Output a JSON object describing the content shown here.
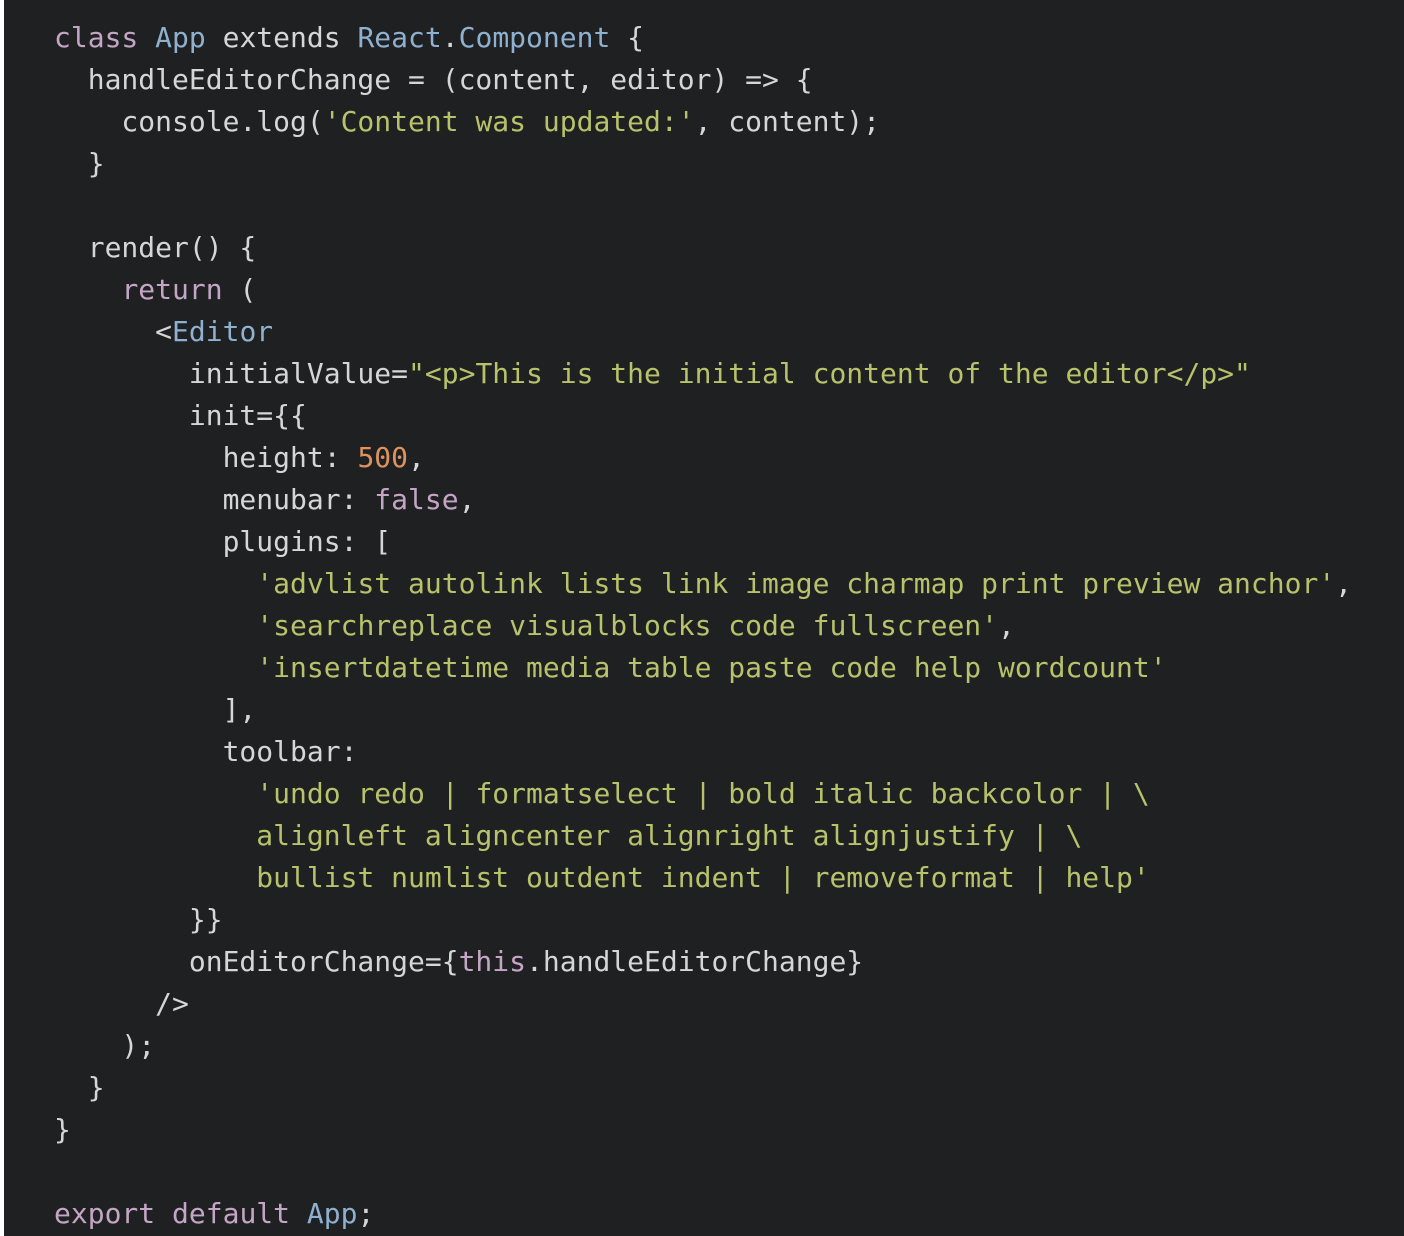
{
  "colors": {
    "background": "#1f2022",
    "plain": "#d6d6d6",
    "keyword": "#c5a5c5",
    "class": "#8fb0cf",
    "string": "#b8c26a",
    "number": "#de935f"
  },
  "code": {
    "language": "jsx",
    "lines": [
      [
        [
          "keyword",
          "class"
        ],
        [
          "plain",
          " "
        ],
        [
          "class",
          "App"
        ],
        [
          "plain",
          " extends "
        ],
        [
          "class",
          "React"
        ],
        [
          "plain",
          "."
        ],
        [
          "class",
          "Component"
        ],
        [
          "plain",
          " {"
        ]
      ],
      [
        [
          "plain",
          "  handleEditorChange = (content, editor) => {"
        ]
      ],
      [
        [
          "plain",
          "    console.log("
        ],
        [
          "string",
          "'Content was updated:'"
        ],
        [
          "plain",
          ", content);"
        ]
      ],
      [
        [
          "plain",
          "  }"
        ]
      ],
      [],
      [
        [
          "plain",
          "  render() {"
        ]
      ],
      [
        [
          "plain",
          "    "
        ],
        [
          "keyword",
          "return"
        ],
        [
          "plain",
          " ("
        ]
      ],
      [
        [
          "plain",
          "      <"
        ],
        [
          "class",
          "Editor"
        ]
      ],
      [
        [
          "plain",
          "        initialValue="
        ],
        [
          "string",
          "\"<p>This is the initial content of the editor</p>\""
        ]
      ],
      [
        [
          "plain",
          "        init={{"
        ]
      ],
      [
        [
          "plain",
          "          height: "
        ],
        [
          "number",
          "500"
        ],
        [
          "plain",
          ","
        ]
      ],
      [
        [
          "plain",
          "          menubar: "
        ],
        [
          "keyword",
          "false"
        ],
        [
          "plain",
          ","
        ]
      ],
      [
        [
          "plain",
          "          plugins: ["
        ]
      ],
      [
        [
          "plain",
          "            "
        ],
        [
          "string",
          "'advlist autolink lists link image charmap print preview anchor'"
        ],
        [
          "plain",
          ","
        ]
      ],
      [
        [
          "plain",
          "            "
        ],
        [
          "string",
          "'searchreplace visualblocks code fullscreen'"
        ],
        [
          "plain",
          ","
        ]
      ],
      [
        [
          "plain",
          "            "
        ],
        [
          "string",
          "'insertdatetime media table paste code help wordcount'"
        ]
      ],
      [
        [
          "plain",
          "          ],"
        ]
      ],
      [
        [
          "plain",
          "          toolbar:"
        ]
      ],
      [
        [
          "plain",
          "            "
        ],
        [
          "string",
          "'undo redo | formatselect | bold italic backcolor | \\"
        ]
      ],
      [
        [
          "plain",
          "            "
        ],
        [
          "string",
          "alignleft aligncenter alignright alignjustify | \\"
        ]
      ],
      [
        [
          "plain",
          "            "
        ],
        [
          "string",
          "bullist numlist outdent indent | removeformat | help'"
        ]
      ],
      [
        [
          "plain",
          "        }}"
        ]
      ],
      [
        [
          "plain",
          "        onEditorChange={"
        ],
        [
          "keyword",
          "this"
        ],
        [
          "plain",
          ".handleEditorChange}"
        ]
      ],
      [
        [
          "plain",
          "      />"
        ]
      ],
      [
        [
          "plain",
          "    );"
        ]
      ],
      [
        [
          "plain",
          "  }"
        ]
      ],
      [
        [
          "plain",
          "}"
        ]
      ],
      [],
      [
        [
          "keyword",
          "export"
        ],
        [
          "plain",
          " "
        ],
        [
          "keyword",
          "default"
        ],
        [
          "plain",
          " "
        ],
        [
          "class",
          "App"
        ],
        [
          "plain",
          ";"
        ]
      ]
    ]
  }
}
